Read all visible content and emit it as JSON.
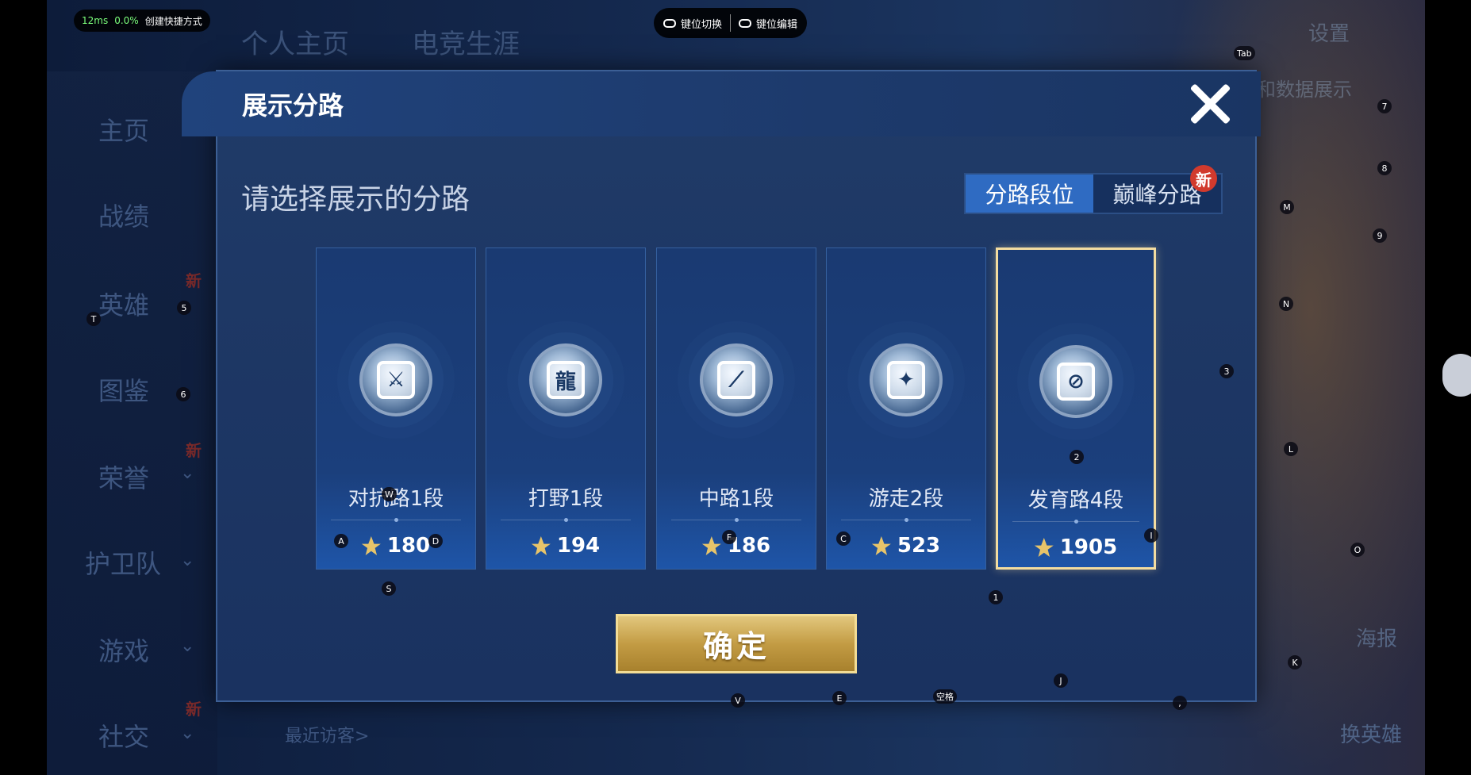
{
  "overlay": {
    "latency": "12ms",
    "loss": "0.0%",
    "shortcut_label": "创建快捷方式",
    "key_switch": "键位切换",
    "key_edit": "键位编辑"
  },
  "background": {
    "tabs": [
      "个人主页",
      "电竞生涯"
    ],
    "sidebar": [
      {
        "label": "主页"
      },
      {
        "label": "战绩"
      },
      {
        "label": "英雄",
        "badge": "新"
      },
      {
        "label": "图鉴"
      },
      {
        "label": "荣誉",
        "badge": "新"
      },
      {
        "label": "护卫队"
      },
      {
        "label": "游戏"
      },
      {
        "label": "社交",
        "badge": "新"
      }
    ],
    "settings": "设置",
    "data_show": "和数据展示",
    "recent_visitors": "最近访客>",
    "poster": "海报",
    "change_hero": "换英雄"
  },
  "modal": {
    "title": "展示分路",
    "subtitle": "请选择展示的分路",
    "segments": [
      {
        "label": "分路段位",
        "active": true
      },
      {
        "label": "巅峰分路",
        "active": false
      }
    ],
    "new_badge": "新",
    "cards": [
      {
        "rank": "对抗路1段",
        "score": "180",
        "icon": "sword-shield-icon",
        "selected": false
      },
      {
        "rank": "打野1段",
        "score": "194",
        "icon": "dragon-icon",
        "selected": false
      },
      {
        "rank": "中路1段",
        "score": "186",
        "icon": "slash-shield-icon",
        "selected": false
      },
      {
        "rank": "游走2段",
        "score": "523",
        "icon": "wings-icon",
        "selected": false
      },
      {
        "rank": "发育路4段",
        "score": "1905",
        "icon": "target-icon",
        "selected": true
      }
    ],
    "confirm_label": "确定"
  },
  "key_hints": [
    "Tab",
    "7",
    "8",
    "M",
    "9",
    "N",
    "5",
    "T",
    "6",
    "3",
    "2",
    "L",
    "W",
    "A",
    "D",
    "F",
    "C",
    "I",
    "O",
    "S",
    "1",
    "K",
    "J",
    "V",
    "E",
    "空格",
    ","
  ]
}
